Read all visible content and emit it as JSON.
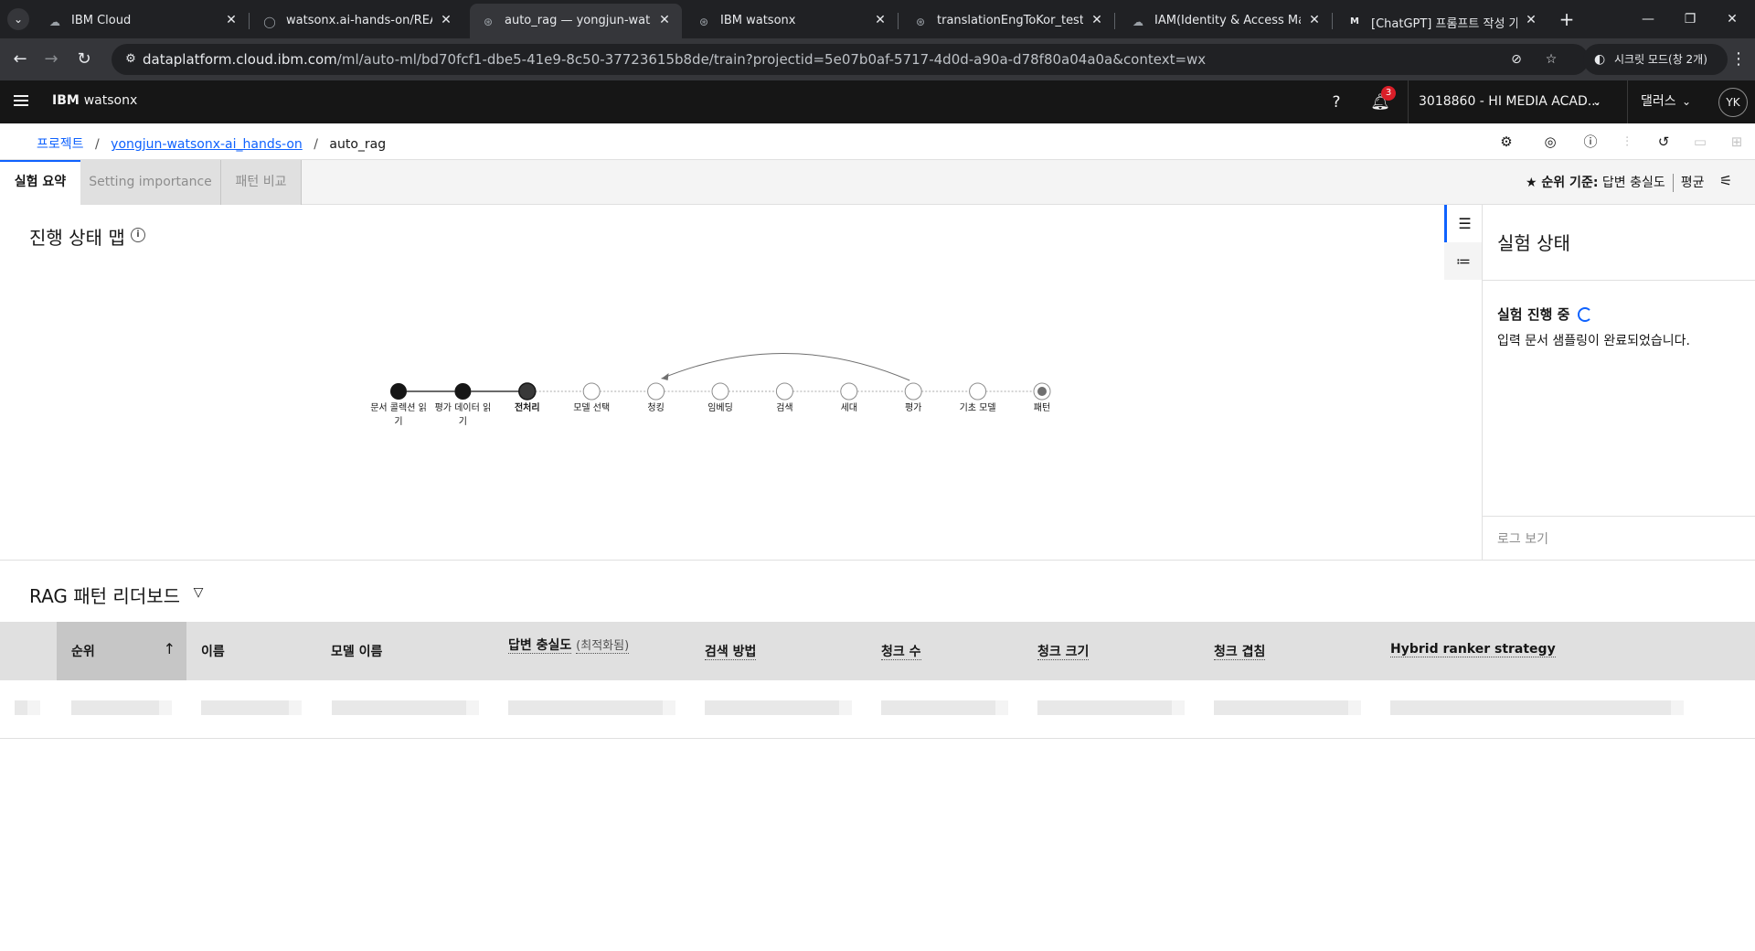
{
  "browser": {
    "tabs": [
      {
        "title": "IBM Cloud",
        "icon": "ibm-cloud-icon"
      },
      {
        "title": "watsonx.ai-hands-on/README",
        "icon": "github-icon"
      },
      {
        "title": "auto_rag — yongjun-watsonx",
        "icon": "watsonx-icon"
      },
      {
        "title": "IBM watsonx",
        "icon": "watsonx-icon"
      },
      {
        "title": "translationEngToKor_test — yo",
        "icon": "watsonx-icon"
      },
      {
        "title": "IAM(Identity & Access Manag",
        "icon": "ibm-cloud-icon"
      },
      {
        "title": "[ChatGPT] 프롬프트 작성 가이",
        "icon": "medium-icon"
      }
    ],
    "url_host": "dataplatform.cloud.ibm.com",
    "url_path": "/ml/auto-ml/bd70fcf1-dbe5-41e9-8c50-37723615b8de/train?projectid=5e07b0af-5717-4d0d-a90a-d78f80a04a0a&context=wx",
    "incognito_label": "시크릿 모드(창 2개)"
  },
  "header": {
    "brand_bold": "IBM",
    "brand_light": "watsonx",
    "notification_count": "3",
    "account": "3018860 - HI MEDIA ACAD...",
    "region": "댈러스",
    "avatar": "YK"
  },
  "breadcrumb": {
    "root": "프로젝트",
    "project": "yongjun-watsonx-ai_hands-on",
    "current": "auto_rag"
  },
  "tabs": {
    "summary": "실험 요약",
    "importance": "Setting importance",
    "compare": "패턴 비교"
  },
  "ranking": {
    "label": "★ 순위 기준:",
    "metric": "답변 충실도",
    "aggregate": "평균"
  },
  "progress_map": {
    "title": "진행 상태 맵",
    "nodes": [
      {
        "label_lines": [
          "문서 콜렉션 읽",
          "기"
        ],
        "state": "done"
      },
      {
        "label_lines": [
          "평가 데이터 읽",
          "기"
        ],
        "state": "done"
      },
      {
        "label_lines": [
          "전처리"
        ],
        "state": "current"
      },
      {
        "label_lines": [
          "모델 선택"
        ],
        "state": "pending"
      },
      {
        "label_lines": [
          "청킹"
        ],
        "state": "pending"
      },
      {
        "label_lines": [
          "임베딩"
        ],
        "state": "pending"
      },
      {
        "label_lines": [
          "검색"
        ],
        "state": "pending"
      },
      {
        "label_lines": [
          "세대"
        ],
        "state": "pending"
      },
      {
        "label_lines": [
          "평가"
        ],
        "state": "pending"
      },
      {
        "label_lines": [
          "기초 모델"
        ],
        "state": "pending"
      },
      {
        "label_lines": [
          "패턴"
        ],
        "state": "final"
      }
    ],
    "loop": {
      "from": "평가",
      "to": "청킹"
    }
  },
  "status_panel": {
    "title": "실험 상태",
    "running": "실험 진행 중",
    "message": "입력 문서 샘플링이 완료되었습니다.",
    "log_link": "로그 보기"
  },
  "leaderboard": {
    "title": "RAG 패턴 리더보드",
    "columns": [
      {
        "label": "순위",
        "sub": ""
      },
      {
        "label": "이름",
        "sub": ""
      },
      {
        "label": "모델 이름",
        "sub": ""
      },
      {
        "label": "답변 충실도",
        "sub": "(최적화됨)"
      },
      {
        "label": "검색 방법",
        "sub": ""
      },
      {
        "label": "청크 수",
        "sub": ""
      },
      {
        "label": "청크 크기",
        "sub": ""
      },
      {
        "label": "청크 겹침",
        "sub": ""
      },
      {
        "label": "Hybrid ranker strategy",
        "sub": ""
      }
    ],
    "sorted_column": "순위",
    "sort_direction": "ascending",
    "rows_loading": true
  },
  "colors": {
    "accent": "#0f62fe",
    "header_bg": "#161616",
    "badge": "#da1e28"
  }
}
